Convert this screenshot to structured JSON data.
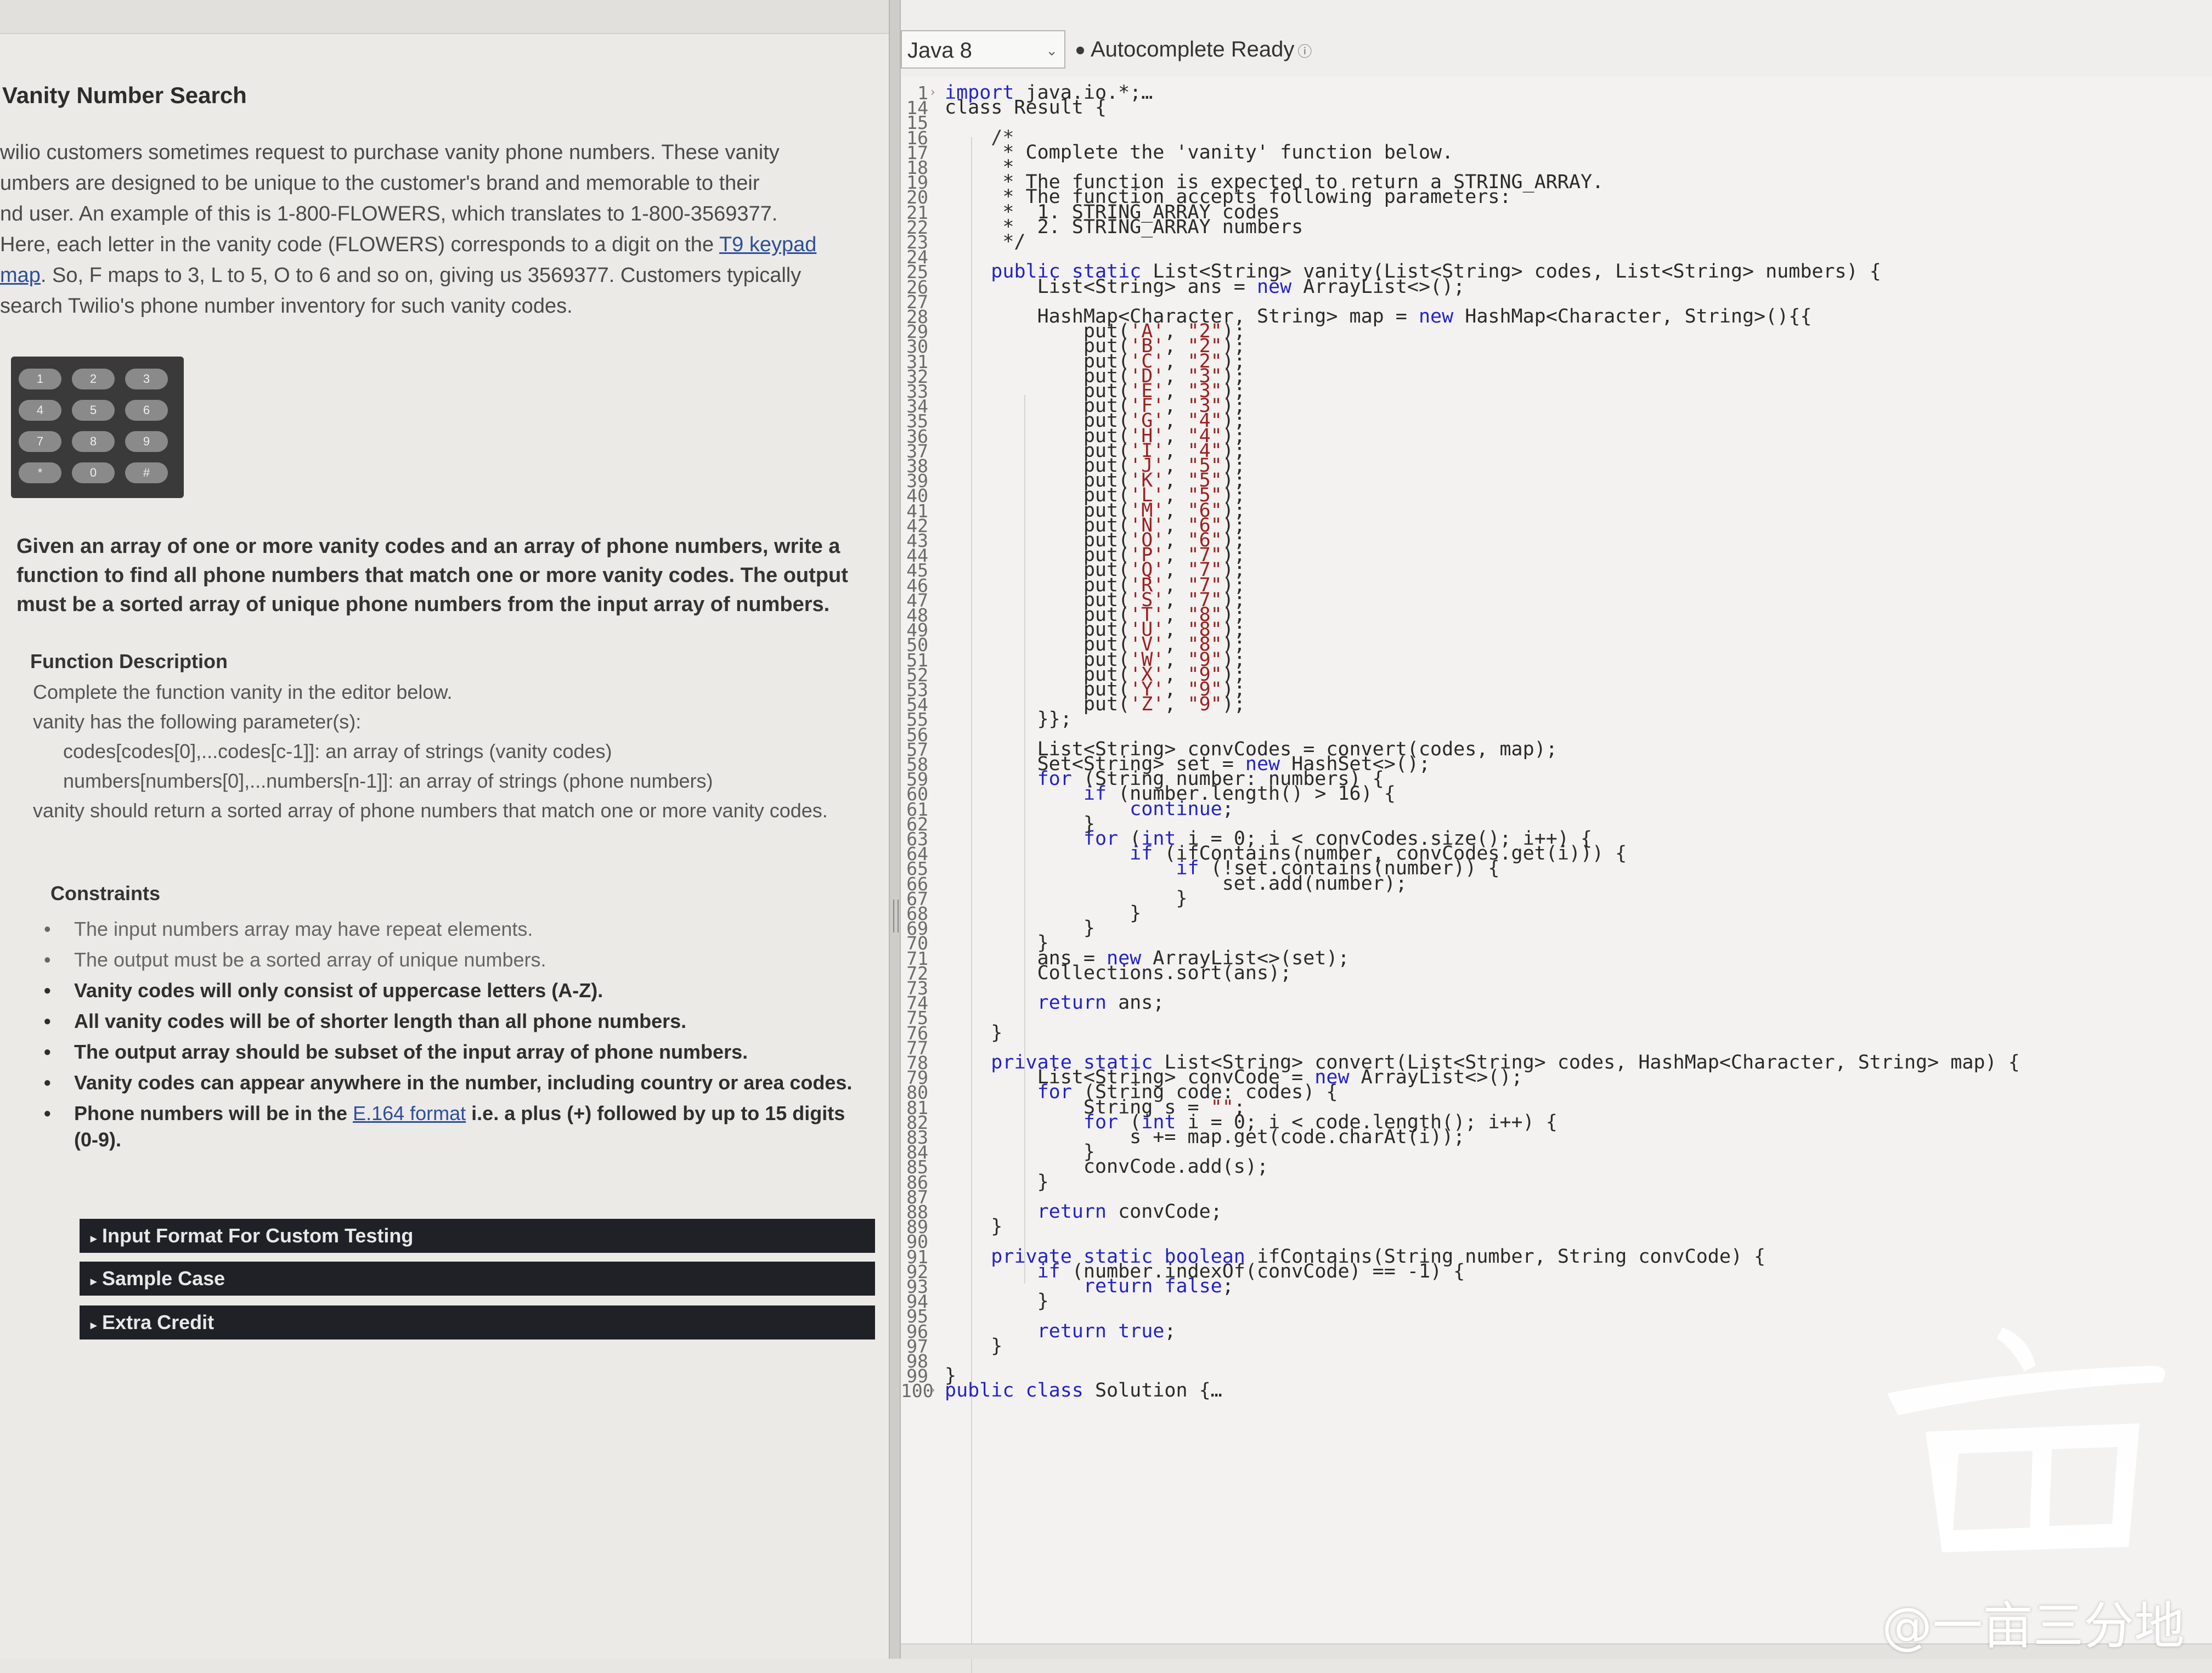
{
  "problem": {
    "title": "Vanity Number Search",
    "intro": [
      {
        "pre": "wilio customers sometimes request to purchase vanity phone numbers. These vanity"
      },
      {
        "pre": "umbers are designed to be unique to the customer's brand and memorable to their"
      },
      {
        "pre": "nd user. An example of this is 1-800-FLOWERS, which translates to 1-800-3569377."
      },
      {
        "pre": "Here, each letter in the vanity code (FLOWERS) corresponds to a digit on the ",
        "link": "T9 keypad"
      },
      {
        "link": "map",
        "post": ". So, F maps to 3, L to 5, O to 6 and so on, giving us 3569377. Customers typically"
      },
      {
        "pre": "search Twilio's phone number inventory for such vanity codes."
      }
    ],
    "keypad_keys": [
      "1",
      "2",
      "3",
      "4",
      "5",
      "6",
      "7",
      "8",
      "9",
      "*",
      "0",
      "#"
    ],
    "given": "Given an array of one or more vanity codes and an array of phone numbers, write a function to find all phone numbers that match one or more vanity codes. The output must be a sorted array of unique phone numbers from the input array of numbers.",
    "function_description_heading": "Function Description",
    "function_description": [
      {
        "text": "Complete the function vanity in the editor below.",
        "indent": false
      },
      {
        "text": "vanity has the following parameter(s):",
        "indent": false
      },
      {
        "text": "codes[codes[0],...codes[c-1]]: an array of strings (vanity codes)",
        "indent": true
      },
      {
        "text": "numbers[numbers[0],...numbers[n-1]]:  an array of strings (phone numbers)",
        "indent": true
      },
      {
        "text": "vanity should return a sorted array of phone numbers that match one or more vanity codes.",
        "indent": false
      }
    ],
    "constraints_heading": "Constraints",
    "constraints": [
      {
        "text": "The input numbers array may have repeat elements.",
        "bold": false
      },
      {
        "text": "The output must be a sorted array of unique numbers.",
        "bold": false
      },
      {
        "text": "Vanity codes will only consist of uppercase letters (A-Z).",
        "bold": true
      },
      {
        "text": "All vanity codes will be of shorter length than all phone numbers.",
        "bold": true
      },
      {
        "text": "The output array should be subset of the input array of phone numbers.",
        "bold": true
      },
      {
        "text": "Vanity codes can appear anywhere in the number, including country or area codes.",
        "bold": true
      },
      {
        "pre": "Phone numbers will be in the ",
        "link": "E.164 format",
        "post": " i.e. a plus (+) followed by up to 15 digits (0-9).",
        "bold": true
      }
    ],
    "sections": [
      "Input Format For Custom Testing",
      "Sample Case",
      "Extra Credit"
    ]
  },
  "editor": {
    "language": "Java 8",
    "status": "Autocomplete Ready",
    "lines": [
      {
        "n": "1",
        "html": "<span class=\"kw\">import</span> java.io.*;…",
        "fold": true
      },
      {
        "n": "14",
        "html": "class Result {"
      },
      {
        "n": "15",
        "html": ""
      },
      {
        "n": "16",
        "html": "    <span class=\"cm\">/*</span>"
      },
      {
        "n": "17",
        "html": "     * Complete the 'vanity' function below."
      },
      {
        "n": "18",
        "html": "     *"
      },
      {
        "n": "19",
        "html": "     * The function is expected to return a STRING_ARRAY."
      },
      {
        "n": "20",
        "html": "     * The function accepts following parameters:"
      },
      {
        "n": "21",
        "html": "     *  1. STRING_ARRAY codes"
      },
      {
        "n": "22",
        "html": "     *  2. STRING_ARRAY numbers"
      },
      {
        "n": "23",
        "html": "     */"
      },
      {
        "n": "24",
        "html": ""
      },
      {
        "n": "25",
        "html": "    <span class=\"kw\">public static</span> List&lt;String&gt; vanity(List&lt;String&gt; codes, List&lt;String&gt; numbers) {"
      },
      {
        "n": "26",
        "html": "        List&lt;String&gt; ans = <span class=\"kw\">new</span> ArrayList&lt;&gt;();"
      },
      {
        "n": "27",
        "html": ""
      },
      {
        "n": "28",
        "html": "        HashMap&lt;Character, String&gt; map = <span class=\"kw\">new</span> HashMap&lt;Character, String&gt;(){{"
      },
      {
        "n": "29",
        "html": "            put(<span class=\"str\">'A'</span>, <span class=\"str\">\"2\"</span>);"
      },
      {
        "n": "30",
        "html": "            put(<span class=\"str\">'B'</span>, <span class=\"str\">\"2\"</span>);"
      },
      {
        "n": "31",
        "html": "            put(<span class=\"str\">'C'</span>, <span class=\"str\">\"2\"</span>);"
      },
      {
        "n": "32",
        "html": "            put(<span class=\"str\">'D'</span>, <span class=\"str\">\"3\"</span>);"
      },
      {
        "n": "33",
        "html": "            put(<span class=\"str\">'E'</span>, <span class=\"str\">\"3\"</span>);"
      },
      {
        "n": "34",
        "html": "            put(<span class=\"str\">'F'</span>, <span class=\"str\">\"3\"</span>);"
      },
      {
        "n": "35",
        "html": "            put(<span class=\"str\">'G'</span>, <span class=\"str\">\"4\"</span>);"
      },
      {
        "n": "36",
        "html": "            put(<span class=\"str\">'H'</span>, <span class=\"str\">\"4\"</span>);"
      },
      {
        "n": "37",
        "html": "            put(<span class=\"str\">'I'</span>, <span class=\"str\">\"4\"</span>);"
      },
      {
        "n": "38",
        "html": "            put(<span class=\"str\">'J'</span>, <span class=\"str\">\"5\"</span>);"
      },
      {
        "n": "39",
        "html": "            put(<span class=\"str\">'K'</span>, <span class=\"str\">\"5\"</span>);"
      },
      {
        "n": "40",
        "html": "            put(<span class=\"str\">'L'</span>, <span class=\"str\">\"5\"</span>);"
      },
      {
        "n": "41",
        "html": "            put(<span class=\"str\">'M'</span>, <span class=\"str\">\"6\"</span>);"
      },
      {
        "n": "42",
        "html": "            put(<span class=\"str\">'N'</span>, <span class=\"str\">\"6\"</span>);"
      },
      {
        "n": "43",
        "html": "            put(<span class=\"str\">'O'</span>, <span class=\"str\">\"6\"</span>);"
      },
      {
        "n": "44",
        "html": "            put(<span class=\"str\">'P'</span>, <span class=\"str\">\"7\"</span>);"
      },
      {
        "n": "45",
        "html": "            put(<span class=\"str\">'Q'</span>, <span class=\"str\">\"7\"</span>);"
      },
      {
        "n": "46",
        "html": "            put(<span class=\"str\">'R'</span>, <span class=\"str\">\"7\"</span>);"
      },
      {
        "n": "47",
        "html": "            put(<span class=\"str\">'S'</span>, <span class=\"str\">\"7\"</span>);"
      },
      {
        "n": "48",
        "html": "            put(<span class=\"str\">'T'</span>, <span class=\"str\">\"8\"</span>);"
      },
      {
        "n": "49",
        "html": "            put(<span class=\"str\">'U'</span>, <span class=\"str\">\"8\"</span>);"
      },
      {
        "n": "50",
        "html": "            put(<span class=\"str\">'V'</span>, <span class=\"str\">\"8\"</span>);"
      },
      {
        "n": "51",
        "html": "            put(<span class=\"str\">'W'</span>, <span class=\"str\">\"9\"</span>);"
      },
      {
        "n": "52",
        "html": "            put(<span class=\"str\">'X'</span>, <span class=\"str\">\"9\"</span>);"
      },
      {
        "n": "53",
        "html": "            put(<span class=\"str\">'Y'</span>, <span class=\"str\">\"9\"</span>);"
      },
      {
        "n": "54",
        "html": "            put(<span class=\"str\">'Z'</span>, <span class=\"str\">\"9\"</span>);"
      },
      {
        "n": "55",
        "html": "        }};"
      },
      {
        "n": "56",
        "html": ""
      },
      {
        "n": "57",
        "html": "        List&lt;String&gt; convCodes = convert(codes, map);"
      },
      {
        "n": "58",
        "html": "        Set&lt;String&gt; set = <span class=\"kw\">new</span> HashSet&lt;&gt;();"
      },
      {
        "n": "59",
        "html": "        <span class=\"kw\">for</span> (String number: numbers) {"
      },
      {
        "n": "60",
        "html": "            <span class=\"kw\">if</span> (number.length() &gt; 16) {"
      },
      {
        "n": "61",
        "html": "                <span class=\"kw\">continue</span>;"
      },
      {
        "n": "62",
        "html": "            }"
      },
      {
        "n": "63",
        "html": "            <span class=\"kw\">for</span> (<span class=\"kw\">int</span> i = 0; i &lt; convCodes.size(); i++) {"
      },
      {
        "n": "64",
        "html": "                <span class=\"kw\">if</span> (ifContains(number, convCodes.get(i))) {"
      },
      {
        "n": "65",
        "html": "                    <span class=\"kw\">if</span> (!set.contains(number)) {"
      },
      {
        "n": "66",
        "html": "                        set.add(number);"
      },
      {
        "n": "67",
        "html": "                    }"
      },
      {
        "n": "68",
        "html": "                }"
      },
      {
        "n": "69",
        "html": "            }"
      },
      {
        "n": "70",
        "html": "        }"
      },
      {
        "n": "71",
        "html": "        ans = <span class=\"kw\">new</span> ArrayList&lt;&gt;(set);"
      },
      {
        "n": "72",
        "html": "        Collections.sort(ans);"
      },
      {
        "n": "73",
        "html": ""
      },
      {
        "n": "74",
        "html": "        <span class=\"kw\">return</span> ans;"
      },
      {
        "n": "75",
        "html": ""
      },
      {
        "n": "76",
        "html": "    }"
      },
      {
        "n": "77",
        "html": ""
      },
      {
        "n": "78",
        "html": "    <span class=\"kw\">private static</span> List&lt;String&gt; convert(List&lt;String&gt; codes, HashMap&lt;Character, String&gt; map) {"
      },
      {
        "n": "79",
        "html": "        List&lt;String&gt; convCode = <span class=\"kw\">new</span> ArrayList&lt;&gt;();"
      },
      {
        "n": "80",
        "html": "        <span class=\"kw\">for</span> (String code: codes) {"
      },
      {
        "n": "81",
        "html": "            String s = <span class=\"str\">\"\"</span>;"
      },
      {
        "n": "82",
        "html": "            <span class=\"kw\">for</span> (<span class=\"kw\">int</span> i = 0; i &lt; code.length(); i++) {"
      },
      {
        "n": "83",
        "html": "                s += map.get(code.charAt(i));"
      },
      {
        "n": "84",
        "html": "            }"
      },
      {
        "n": "85",
        "html": "            convCode.add(s);"
      },
      {
        "n": "86",
        "html": "        }"
      },
      {
        "n": "87",
        "html": ""
      },
      {
        "n": "88",
        "html": "        <span class=\"kw\">return</span> convCode;"
      },
      {
        "n": "89",
        "html": "    }"
      },
      {
        "n": "90",
        "html": ""
      },
      {
        "n": "91",
        "html": "    <span class=\"kw\">private static boolean</span> ifContains(String number, String convCode) {"
      },
      {
        "n": "92",
        "html": "        <span class=\"kw\">if</span> (number.indexOf(convCode) == -1) {"
      },
      {
        "n": "93",
        "html": "            <span class=\"kw\">return false</span>;"
      },
      {
        "n": "94",
        "html": "        }"
      },
      {
        "n": "95",
        "html": ""
      },
      {
        "n": "96",
        "html": "        <span class=\"kw\">return true</span>;"
      },
      {
        "n": "97",
        "html": "    }"
      },
      {
        "n": "98",
        "html": ""
      },
      {
        "n": "99",
        "html": "}"
      },
      {
        "n": "100",
        "html": "<span class=\"kw\">public class</span> Solution {…",
        "fold": true
      }
    ]
  },
  "watermark": {
    "text": "@一亩三分地"
  },
  "colors": {
    "section_bar": "#1f2127",
    "keyword": "#2323c8",
    "string": "#9c2020",
    "link": "#2d4f9a"
  }
}
